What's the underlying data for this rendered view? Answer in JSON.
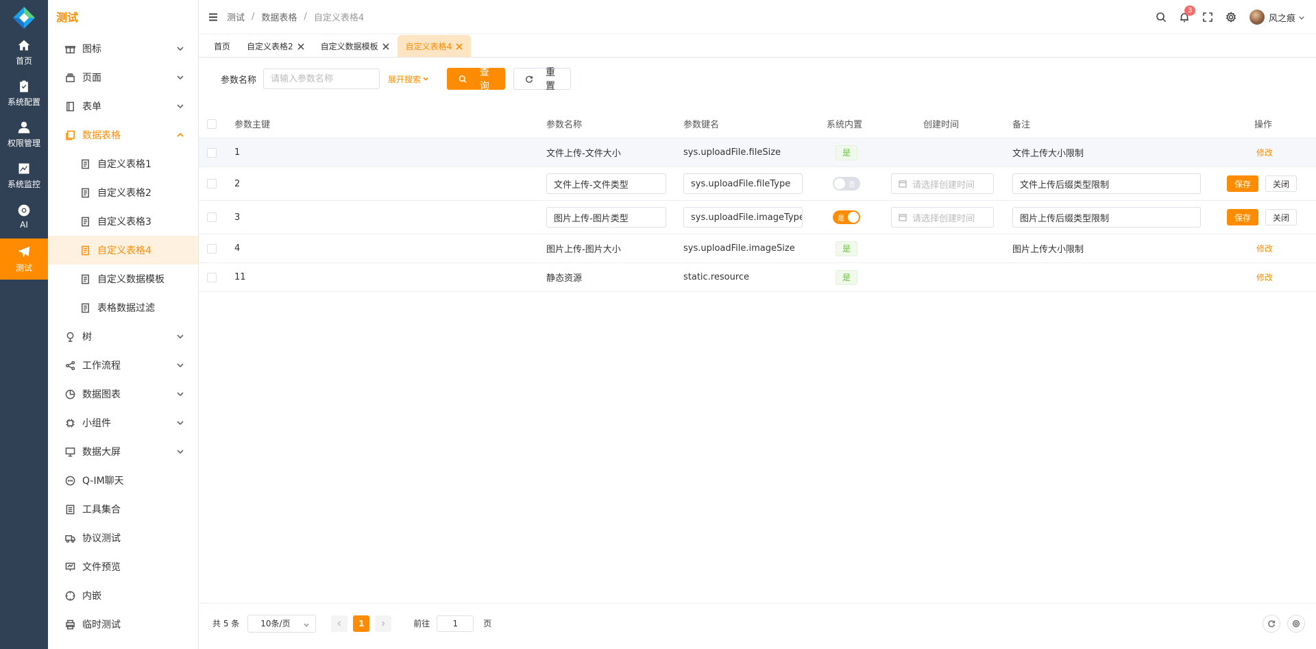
{
  "rail": {
    "items": [
      {
        "label": "首页",
        "icon": "home-icon"
      },
      {
        "label": "系统配置",
        "icon": "clipboard-icon"
      },
      {
        "label": "权限管理",
        "icon": "user-icon"
      },
      {
        "label": "系统监控",
        "icon": "chart-icon"
      },
      {
        "label": "AI",
        "icon": "chrome-icon"
      },
      {
        "label": "测试",
        "icon": "send-icon"
      }
    ]
  },
  "sidebar": {
    "title": "测试",
    "items": [
      {
        "label": "图标"
      },
      {
        "label": "页面"
      },
      {
        "label": "表单"
      },
      {
        "label": "数据表格"
      },
      {
        "label": "自定义表格1"
      },
      {
        "label": "自定义表格2"
      },
      {
        "label": "自定义表格3"
      },
      {
        "label": "自定义表格4"
      },
      {
        "label": "自定义数据模板"
      },
      {
        "label": "表格数据过滤"
      },
      {
        "label": "树"
      },
      {
        "label": "工作流程"
      },
      {
        "label": "数据图表"
      },
      {
        "label": "小组件"
      },
      {
        "label": "数据大屏"
      },
      {
        "label": "Q-IM聊天"
      },
      {
        "label": "工具集合"
      },
      {
        "label": "协议测试"
      },
      {
        "label": "文件预览"
      },
      {
        "label": "内嵌"
      },
      {
        "label": "临时测试"
      }
    ]
  },
  "header": {
    "breadcrumb": [
      "测试",
      "数据表格",
      "自定义表格4"
    ],
    "breadcrumb_sep": "/",
    "notification_count": "3",
    "user_name": "风之痕"
  },
  "tabs": [
    {
      "label": "首页"
    },
    {
      "label": "自定义表格2"
    },
    {
      "label": "自定义数据模板"
    },
    {
      "label": "自定义表格4"
    }
  ],
  "search": {
    "label": "参数名称",
    "placeholder": "请输入参数名称",
    "expand": "展开搜索",
    "query": "查询",
    "reset": "重置"
  },
  "table": {
    "columns": [
      "参数主键",
      "参数名称",
      "参数键名",
      "系统内置",
      "创建时间",
      "备注",
      "操作"
    ],
    "rows": [
      {
        "id": "1",
        "name": "文件上传-文件大小",
        "key": "sys.uploadFile.fileSize",
        "builtin": "是",
        "remark": "文件上传大小限制",
        "action": "修改"
      },
      {
        "id": "2",
        "name": "文件上传-文件类型",
        "key": "sys.uploadFile.fileType",
        "builtin": "否",
        "date_placeholder": "请选择创建时间",
        "remark": "文件上传后缀类型限制",
        "save": "保存",
        "close": "关闭"
      },
      {
        "id": "3",
        "name": "图片上传-图片类型",
        "key": "sys.uploadFile.imageType",
        "builtin": "是",
        "date_placeholder": "请选择创建时间",
        "remark": "图片上传后缀类型限制",
        "save": "保存",
        "close": "关闭"
      },
      {
        "id": "4",
        "name": "图片上传-图片大小",
        "key": "sys.uploadFile.imageSize",
        "builtin": "是",
        "remark": "图片上传大小限制",
        "action": "修改"
      },
      {
        "id": "11",
        "name": "静态资源",
        "key": "static.resource",
        "builtin": "是",
        "remark": "",
        "action": "修改"
      }
    ]
  },
  "pagination": {
    "total": "共 5 条",
    "page_size": "10条/页",
    "current": "1",
    "goto_label": "前往",
    "goto_value": "1",
    "page_suffix": "页"
  },
  "colors": {
    "accent": "#ff8c00",
    "rail_bg": "#304156",
    "tag_green": "#67c23a"
  }
}
